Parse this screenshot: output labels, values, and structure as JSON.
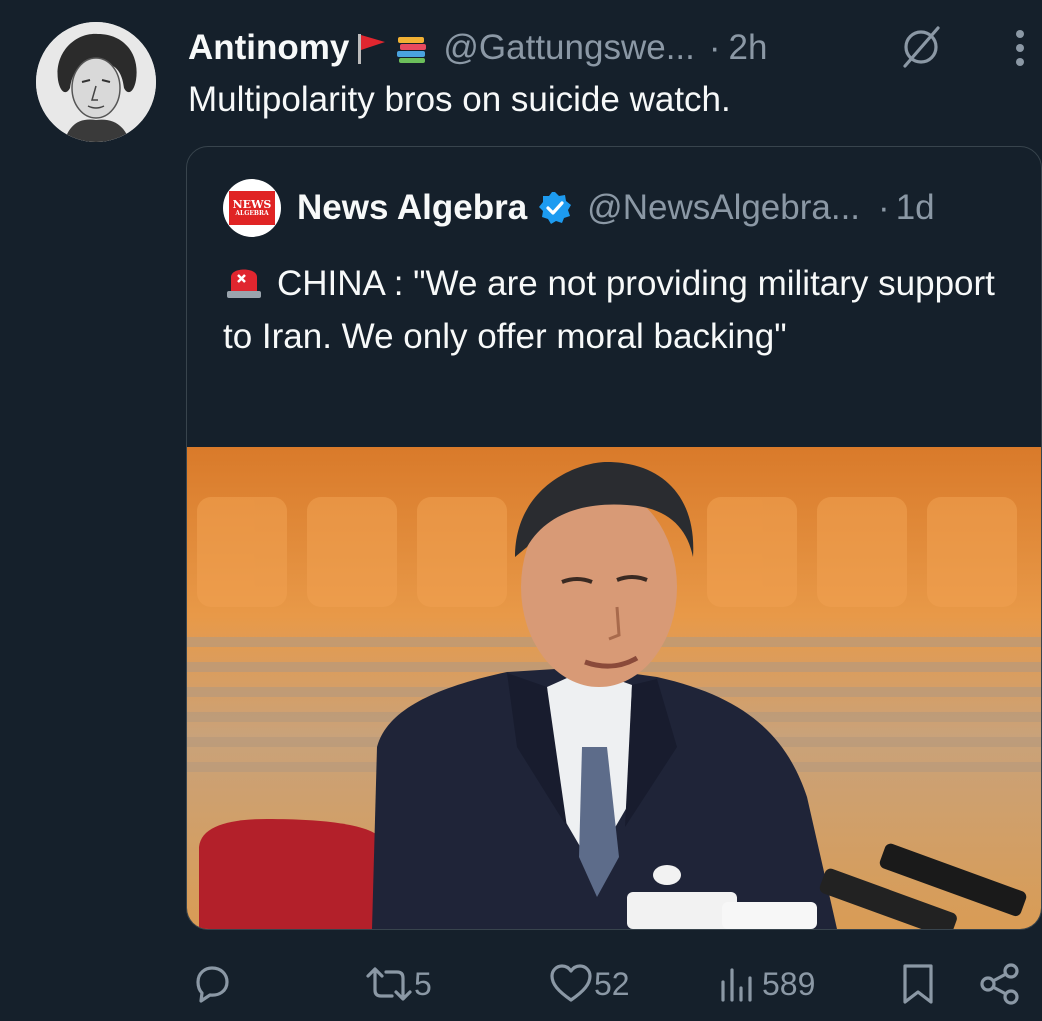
{
  "tweet": {
    "author_name": "Antinomy",
    "author_handle": "@Gattungswe...",
    "separator": "·",
    "time": "2h",
    "text": "Multipolarity bros on suicide watch."
  },
  "quoted": {
    "author_name": "News Algebra",
    "avatar_line1": "NEWS",
    "avatar_line2": "ALGEBRA",
    "author_handle": "@NewsAlgebra...",
    "separator": "·",
    "time": "1d",
    "text": "CHINA : \"We are not providing military support to Iran. We only offer moral backing\""
  },
  "actions": {
    "reply_count": "",
    "retweet_count": "5",
    "like_count": "52",
    "views_count": "589"
  },
  "icons": [
    "red-flag-emoji",
    "books-emoji",
    "grok-icon",
    "more-icon",
    "verified-badge-icon",
    "siren-emoji",
    "reply-icon",
    "retweet-icon",
    "like-icon",
    "views-icon",
    "bookmark-icon",
    "share-icon"
  ],
  "colors": {
    "background": "#15202b",
    "secondary_text": "#8b98a5",
    "border": "#38444d",
    "verified": "#1d9bf0"
  }
}
